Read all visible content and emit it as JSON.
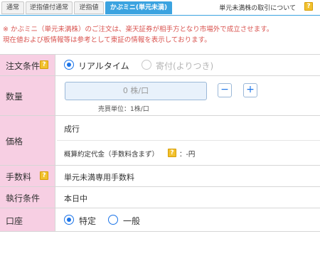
{
  "tabs": [
    "通常",
    "逆指値付通常",
    "逆指値",
    "かぶミニ(単元未満)"
  ],
  "help": {
    "label": "単元未満株の取引について",
    "icon": "?"
  },
  "notice": [
    "※ かぶミニ（単元未満株）のご注文は、楽天証券が相手方となり市場外で成立させます。",
    "現在値および板情報等は参考として東証の情報を表示しております。"
  ],
  "order_condition": {
    "label": "注文条件",
    "options": [
      {
        "label": "リアルタイム",
        "selected": true,
        "disabled": false
      },
      {
        "label": "寄付(よりつき)",
        "selected": false,
        "disabled": true
      }
    ]
  },
  "quantity": {
    "label": "数量",
    "placeholder": "0 株/口",
    "minus": "−",
    "plus": "+",
    "unit_note": "売買単位：1株/口"
  },
  "price": {
    "label": "価格",
    "value": "成行",
    "estimate_label": "概算約定代金（手数料含まず）",
    "estimate_value": "：-円"
  },
  "fee": {
    "label": "手数料",
    "value": "単元未満専用手数料"
  },
  "execution": {
    "label": "執行条件",
    "value": "本日中"
  },
  "account": {
    "label": "口座",
    "options": [
      {
        "label": "特定",
        "selected": true
      },
      {
        "label": "一般",
        "selected": false
      }
    ]
  },
  "colors": {
    "accent": "#3ba3e0",
    "label_bg": "#f7cfe3",
    "notice": "#d9534f",
    "radio": "#1a73e8"
  }
}
